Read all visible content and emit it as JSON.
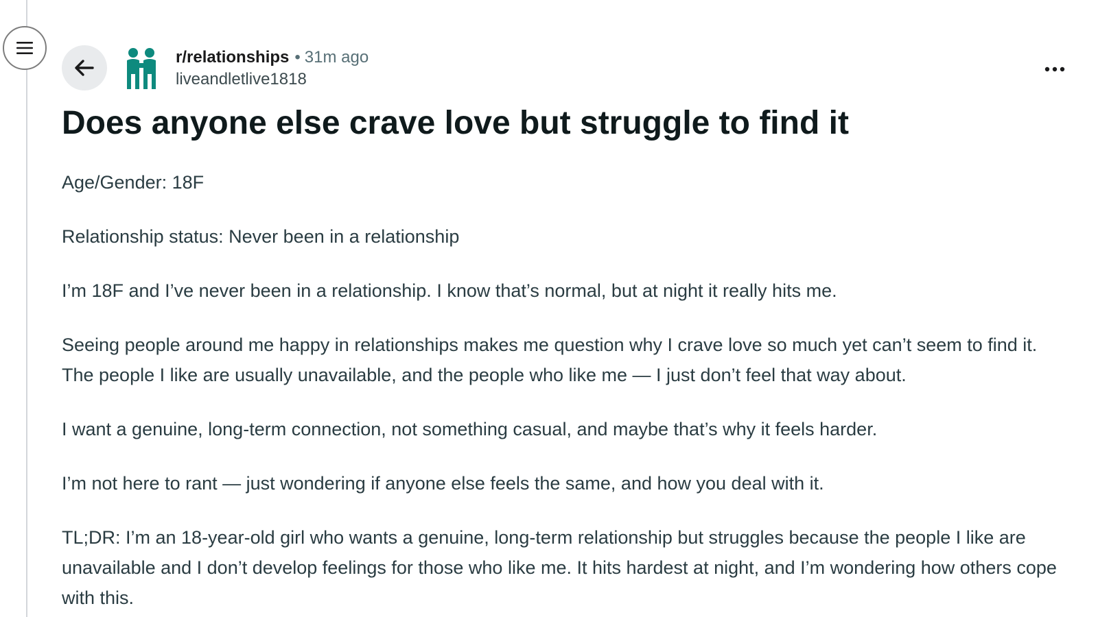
{
  "post": {
    "subreddit": "r/relationships",
    "separator": "•",
    "time_ago": "31m ago",
    "author": "liveandletlive1818",
    "title": "Does anyone else crave love but struggle to find it",
    "paragraphs": [
      "Age/Gender: 18F",
      "Relationship status: Never been in a relationship",
      "I’m 18F and I’ve never been in a relationship. I know that’s normal, but at night it really hits me.",
      "Seeing people around me happy in relationships makes me question why I crave love so much yet can’t seem to find it. The people I like are usually unavailable, and the people who like me — I just don’t feel that way about.",
      "I want a genuine, long-term connection, not something casual, and maybe that’s why it feels harder.",
      "I’m not here to rant — just wondering if anyone else feels the same, and how you deal with it.",
      "TL;DR: I’m an 18-year-old girl who wants a genuine, long-term relationship but struggles because the people I like are unavailable and I don’t develop feelings for those who like me. It hits hardest at night, and I’m wondering how others cope with this."
    ]
  },
  "icons": {
    "menu": "hamburger-menu-icon",
    "back": "arrow-left-icon",
    "subreddit": "relationships-community-icon",
    "more": "more-options-icon"
  },
  "colors": {
    "community_icon": "#0e8a7e",
    "meta_text": "#576f76",
    "back_button_bg": "#e9ebed"
  }
}
